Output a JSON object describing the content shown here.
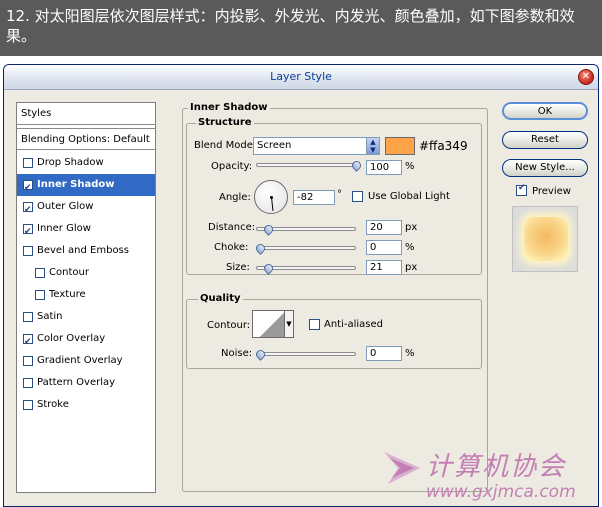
{
  "caption": "12. 对太阳图层依次图层样式：内投影、外发光、内发光、颜色叠加，如下图参数和效果。",
  "dialog": {
    "title": "Layer Style",
    "close_glyph": "✕"
  },
  "styles_panel": {
    "header": "Styles",
    "blending": "Blending Options: Default",
    "items": [
      {
        "label": "Drop Shadow",
        "checked": false,
        "indent": false,
        "selected": false
      },
      {
        "label": "Inner Shadow",
        "checked": true,
        "indent": false,
        "selected": true
      },
      {
        "label": "Outer Glow",
        "checked": true,
        "indent": false,
        "selected": false
      },
      {
        "label": "Inner Glow",
        "checked": true,
        "indent": false,
        "selected": false
      },
      {
        "label": "Bevel and Emboss",
        "checked": false,
        "indent": false,
        "selected": false
      },
      {
        "label": "Contour",
        "checked": false,
        "indent": true,
        "selected": false
      },
      {
        "label": "Texture",
        "checked": false,
        "indent": true,
        "selected": false
      },
      {
        "label": "Satin",
        "checked": false,
        "indent": false,
        "selected": false
      },
      {
        "label": "Color Overlay",
        "checked": true,
        "indent": false,
        "selected": false
      },
      {
        "label": "Gradient Overlay",
        "checked": false,
        "indent": false,
        "selected": false
      },
      {
        "label": "Pattern Overlay",
        "checked": false,
        "indent": false,
        "selected": false
      },
      {
        "label": "Stroke",
        "checked": false,
        "indent": false,
        "selected": false
      }
    ]
  },
  "inner_shadow": {
    "title": "Inner Shadow",
    "structure": {
      "title": "Structure",
      "blend_mode_label": "Blend Mode:",
      "blend_mode_value": "Screen",
      "color": "#ffa349",
      "color_hex_label": "#ffa349",
      "opacity_label": "Opacity:",
      "opacity_value": "100",
      "opacity_fraction": 1.0,
      "angle_label": "Angle:",
      "angle_value": "-82",
      "degree_symbol": "°",
      "global_light_label": "Use Global Light",
      "global_light_checked": false,
      "distance_label": "Distance:",
      "distance_value": "20",
      "distance_fraction": 0.08,
      "choke_label": "Choke:",
      "choke_value": "0",
      "choke_fraction": 0.0,
      "size_label": "Size:",
      "size_value": "21",
      "size_fraction": 0.08,
      "percent_unit": "%",
      "px_unit": "px"
    },
    "quality": {
      "title": "Quality",
      "contour_label": "Contour:",
      "anti_aliased_label": "Anti-aliased",
      "anti_aliased_checked": false,
      "noise_label": "Noise:",
      "noise_value": "0",
      "noise_fraction": 0.0,
      "percent_unit": "%"
    }
  },
  "buttons": {
    "ok": "OK",
    "reset": "Reset",
    "new_style": "New Style...",
    "preview_label": "Preview",
    "preview_checked": true
  },
  "watermark": {
    "text": "计算机协会",
    "url": "www.gxjmca.com"
  },
  "colors": {
    "selection": "#316ac5",
    "accent_title": "#0b3f9a",
    "watermark": "#c37fb4"
  }
}
